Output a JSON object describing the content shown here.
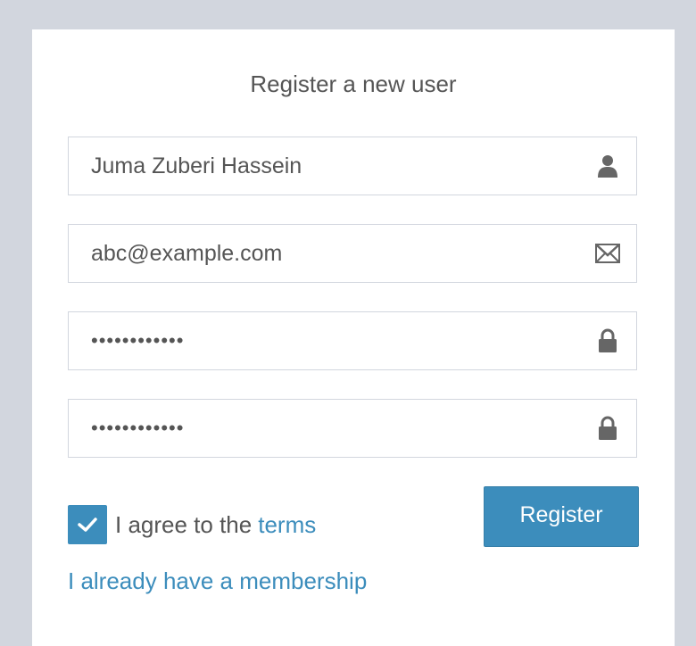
{
  "form": {
    "title": "Register a new user",
    "full_name": {
      "value": "Juma Zuberi Hassein",
      "icon": "user-icon"
    },
    "email": {
      "value": "abc@example.com",
      "icon": "envelope-icon"
    },
    "password": {
      "value": "••••••••••••",
      "icon": "lock-icon"
    },
    "password_confirm": {
      "value": "••••••••••••",
      "icon": "lock-icon"
    },
    "agree": {
      "checked": true,
      "label": "I agree to the",
      "link": "terms"
    },
    "register_button": "Register",
    "membership_link": "I already have a membership"
  },
  "colors": {
    "background": "#d2d6de",
    "accent": "#3c8dbc",
    "icon": "#666666"
  }
}
